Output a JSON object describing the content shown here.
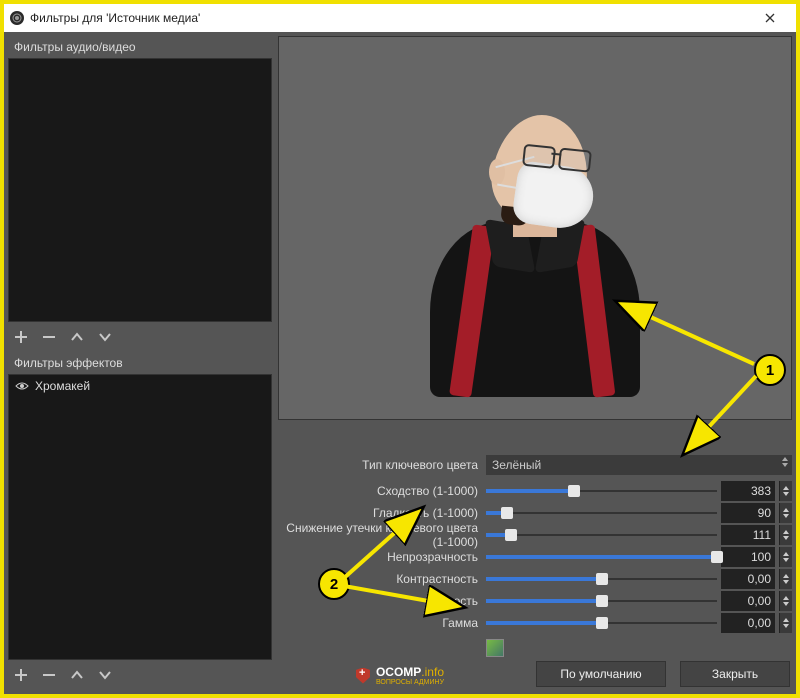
{
  "window": {
    "title": "Фильтры для 'Источник медиа'"
  },
  "left": {
    "audio_video_label": "Фильтры аудио/видео",
    "effects_label": "Фильтры эффектов",
    "effects_items": [
      {
        "label": "Хромакей"
      }
    ]
  },
  "settings": {
    "key_color_type_label": "Тип ключевого цвета",
    "key_color_type_value": "Зелёный",
    "rows": [
      {
        "label": "Сходство (1-1000)",
        "value": "383",
        "pct": 38
      },
      {
        "label": "Гладкость (1-1000)",
        "value": "90",
        "pct": 9
      },
      {
        "label": "Снижение утечки ключевого цвета (1-1000)",
        "value": "111",
        "pct": 11
      },
      {
        "label": "Непрозрачность",
        "value": "100",
        "pct": 100
      },
      {
        "label": "Контрастность",
        "value": "0,00",
        "pct": 50
      },
      {
        "label": "Яркость",
        "value": "0,00",
        "pct": 50
      },
      {
        "label": "Гамма",
        "value": "0,00",
        "pct": 50
      }
    ]
  },
  "buttons": {
    "defaults": "По умолчанию",
    "close": "Закрыть"
  },
  "watermark": {
    "brand": "OCOMP",
    "tld": ".info",
    "sub": "ВОПРОСЫ АДМИНУ"
  },
  "annotations": {
    "one": "1",
    "two": "2"
  }
}
